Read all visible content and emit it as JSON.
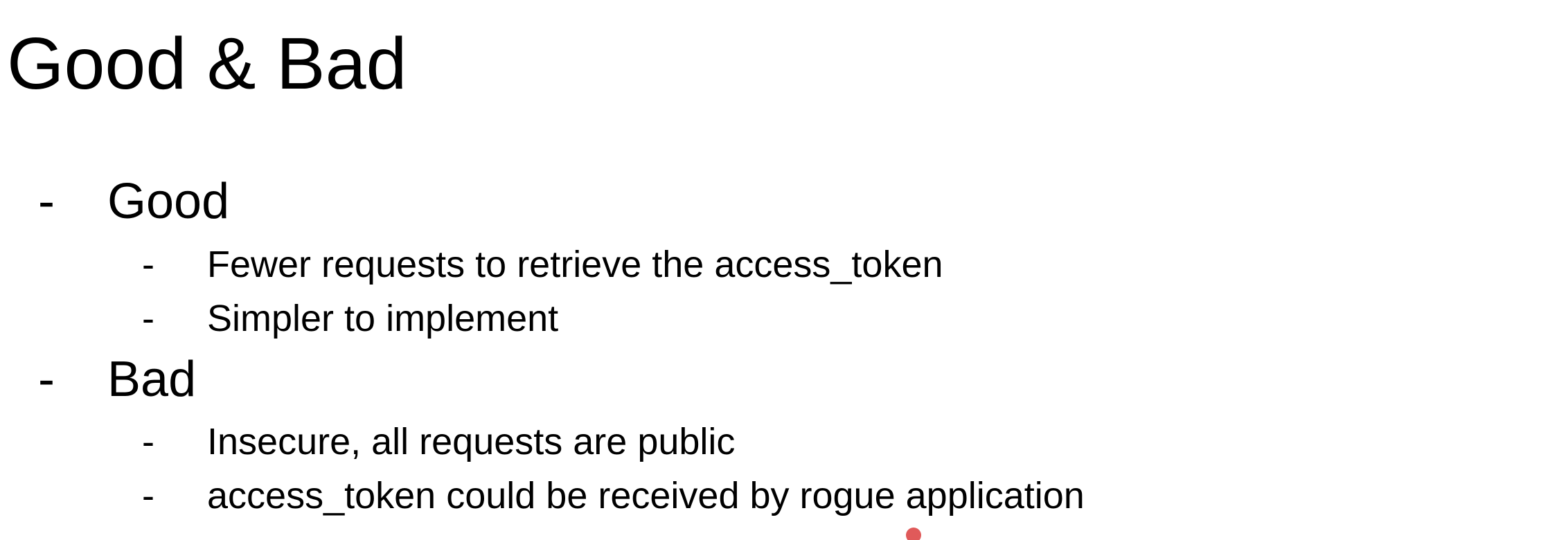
{
  "slide": {
    "title": "Good & Bad",
    "bullet_glyph": "-",
    "sections": [
      {
        "heading": "Good",
        "items": [
          "Fewer requests to retrieve the access_token",
          "Simpler to implement"
        ]
      },
      {
        "heading": "Bad",
        "items": [
          "Insecure, all requests are public",
          "access_token could be received by rogue application"
        ]
      }
    ]
  },
  "colors": {
    "background": "#ffffff",
    "text": "#000000",
    "pointer": "#e05a5a"
  },
  "icons": {
    "pointer": "laser-pointer-dot-icon"
  }
}
